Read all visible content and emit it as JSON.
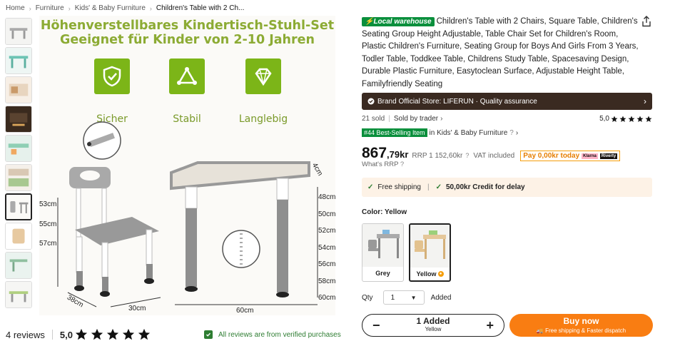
{
  "breadcrumb": {
    "home": "Home",
    "furniture": "Furniture",
    "kids": "Kids' & Baby Furniture",
    "current": "Children's Table with 2 Ch..."
  },
  "hero": {
    "line1": "Höhenverstellbares Kindertisch-Stuhl-Set",
    "line2": "Geeignet für Kinder von 2-10 Jahren",
    "badges": [
      "Sicher",
      "Stabil",
      "Langlebig"
    ],
    "chair_dims": [
      "53cm",
      "55cm",
      "57cm"
    ],
    "table_dims": [
      "48cm",
      "50cm",
      "52cm",
      "54cm",
      "56cm",
      "58cm",
      "60cm"
    ],
    "footprint": [
      "38cm",
      "30cm",
      "60cm"
    ],
    "corner": "4cm"
  },
  "reviews": {
    "count": "4 reviews",
    "rating": "5,0",
    "verified": "All reviews are from verified purchases"
  },
  "product": {
    "local_badge": "Local warehouse",
    "title": "Children's Table with 2 Chairs, Square Table, Children's Seating Group Height Adjustable, Table Chair Set for Children's Room, Plastic Children's Furniture, Seating Group for Boys And Girls From 3 Years, Todler Table, Toddkee Table, Childrens Study Table, Spacesaving Design, Durable Plastic Furniture, Easytoclean Surface, Adjustable Height Table, Familyfriendly Seating",
    "store": "Brand Official Store: LIFERUN · Quality assurance",
    "sold": "21 sold",
    "sold_by": "Sold by trader",
    "rating": "5,0",
    "bestseller_tag": "#44 Best-Selling Item",
    "bestseller_in": "in Kids' & Baby Furniture",
    "price_main": "867",
    "price_frac": ",79kr",
    "rrp": "RRP 1 152,60kr",
    "vat": "VAT included",
    "klarna": "Pay 0,00kr today",
    "klarna_k1": "Klarna",
    "klarna_k2": "Riverty",
    "whats_rrp": "What's RRP",
    "free_shipping": "Free shipping",
    "credit": "50,00kr Credit for delay",
    "color_label": "Color: Yellow",
    "colors": [
      "Grey",
      "Yellow"
    ],
    "qty_label": "Qty",
    "qty_value": "1",
    "qty_added": "Added",
    "cart_added": "1 Added",
    "cart_variant": "Yellow",
    "buy_label": "Buy now",
    "buy_sub": "Free shipping & Faster dispatch"
  },
  "colors": {
    "accent_green": "#0a8f3c",
    "hero_green": "#8cab34",
    "store_bar": "#3a2a21",
    "buy_orange": "#f97d12",
    "ship_bg": "#fdf2e6"
  }
}
